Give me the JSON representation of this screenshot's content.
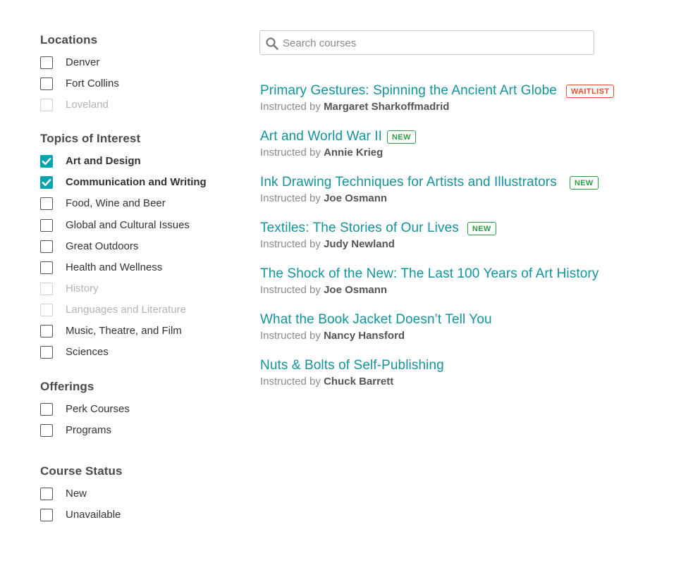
{
  "search": {
    "placeholder": "Search courses",
    "value": ""
  },
  "filters": {
    "locations": {
      "title": "Locations",
      "options": [
        {
          "label": "Denver",
          "checked": false,
          "disabled": false
        },
        {
          "label": "Fort Collins",
          "checked": false,
          "disabled": false
        },
        {
          "label": "Loveland",
          "checked": false,
          "disabled": true
        }
      ]
    },
    "topics": {
      "title": "Topics of Interest",
      "options": [
        {
          "label": "Art and Design",
          "checked": true,
          "disabled": false
        },
        {
          "label": "Communication and Writing",
          "checked": true,
          "disabled": false
        },
        {
          "label": "Food, Wine and Beer",
          "checked": false,
          "disabled": false
        },
        {
          "label": "Global and Cultural Issues",
          "checked": false,
          "disabled": false
        },
        {
          "label": "Great Outdoors",
          "checked": false,
          "disabled": false
        },
        {
          "label": "Health and Wellness",
          "checked": false,
          "disabled": false
        },
        {
          "label": "History",
          "checked": false,
          "disabled": true
        },
        {
          "label": "Languages and Literature",
          "checked": false,
          "disabled": true
        },
        {
          "label": "Music, Theatre, and Film",
          "checked": false,
          "disabled": false
        },
        {
          "label": "Sciences",
          "checked": false,
          "disabled": false
        }
      ]
    },
    "offerings": {
      "title": "Offerings",
      "options": [
        {
          "label": "Perk Courses",
          "checked": false,
          "disabled": false
        },
        {
          "label": "Programs",
          "checked": false,
          "disabled": false
        }
      ]
    },
    "status": {
      "title": "Course Status",
      "options": [
        {
          "label": "New",
          "checked": false,
          "disabled": false
        },
        {
          "label": "Unavailable",
          "checked": false,
          "disabled": false
        }
      ]
    }
  },
  "instructed_by_label": "Instructed by",
  "courses": [
    {
      "title": "Primary Gestures: Spinning the Ancient Art Globe",
      "instructor": "Margaret Sharkoffmadrid",
      "badge": "WAITLIST"
    },
    {
      "title": "Art and World War II",
      "instructor": "Annie Krieg",
      "badge": "NEW"
    },
    {
      "title": "Ink Drawing Techniques for Artists and Illustrators",
      "instructor": "Joe Osmann",
      "badge": "NEW"
    },
    {
      "title": "Textiles: The Stories of Our Lives",
      "instructor": "Judy Newland",
      "badge": "NEW"
    },
    {
      "title": "The Shock of the New: The Last 100 Years of Art History",
      "instructor": "Joe Osmann",
      "badge": ""
    },
    {
      "title": "What the Book Jacket Doesn’t Tell You",
      "instructor": "Nancy Hansford",
      "badge": ""
    },
    {
      "title": "Nuts & Bolts of Self-Publishing",
      "instructor": "Chuck Barrett",
      "badge": ""
    }
  ],
  "colors": {
    "accent": "#00a4ad",
    "link": "#13939c",
    "badge_new": "#2c9e48",
    "badge_waitlist": "#e3502a"
  },
  "icons": {
    "search": "search-icon",
    "check": "checkmark-icon"
  }
}
